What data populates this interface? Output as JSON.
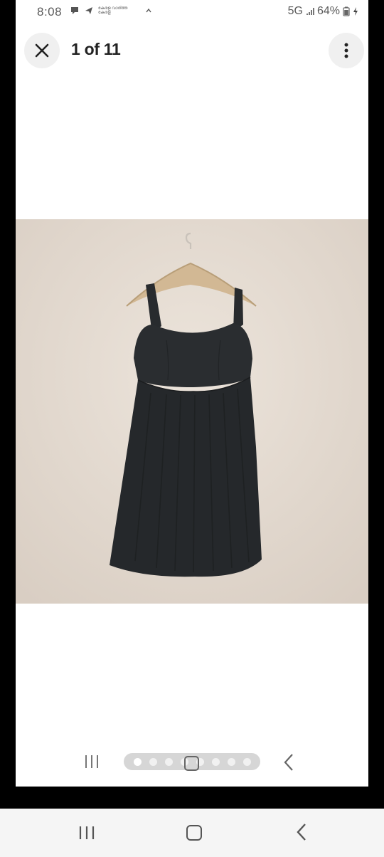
{
  "status_bar": {
    "time": "8:08",
    "network": "5G",
    "battery": "64%",
    "notification_text": "കേരള വാര്ത്ത കേരള"
  },
  "header": {
    "counter": "1 of 11",
    "close_icon": "close-icon",
    "more_icon": "more-vertical-icon"
  },
  "gallery": {
    "image_subject": "black sleeveless dress on hanger",
    "total_images": 11,
    "current_index": 1,
    "visible_dots": 8
  },
  "colors": {
    "background": "#ffffff",
    "image_wall": "#e6ddd3",
    "dress": "#25282b",
    "button_bg": "#f0f0f0"
  }
}
